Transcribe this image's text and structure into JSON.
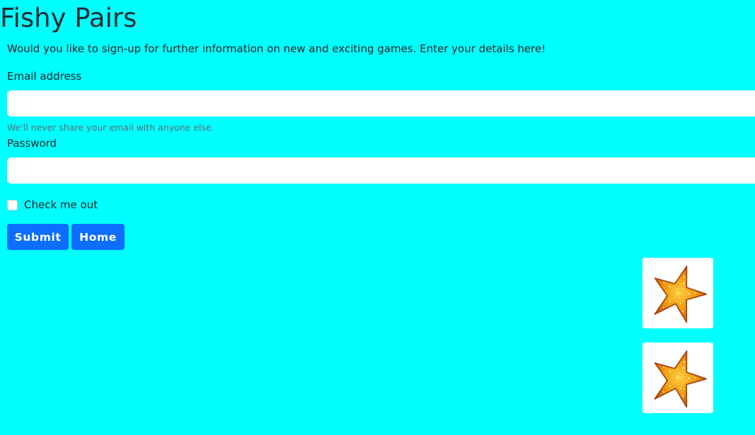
{
  "page": {
    "title": "Fishy Pairs",
    "intro": "Would you like to sign-up for further information on new and exciting games. Enter your details here!",
    "background_color": "#00ffff"
  },
  "form": {
    "email_label": "Email address",
    "email_value": "",
    "email_help": "We'll never share your email with anyone else.",
    "password_label": "Password",
    "password_value": "",
    "checkbox_label": "Check me out",
    "checkbox_checked": false,
    "submit_label": "Submit",
    "home_label": "Home",
    "button_color": "#0d6efd"
  },
  "cards": [
    {
      "icon": "starfish-icon",
      "face_up": true
    },
    {
      "icon": "starfish-icon",
      "face_up": true
    }
  ]
}
